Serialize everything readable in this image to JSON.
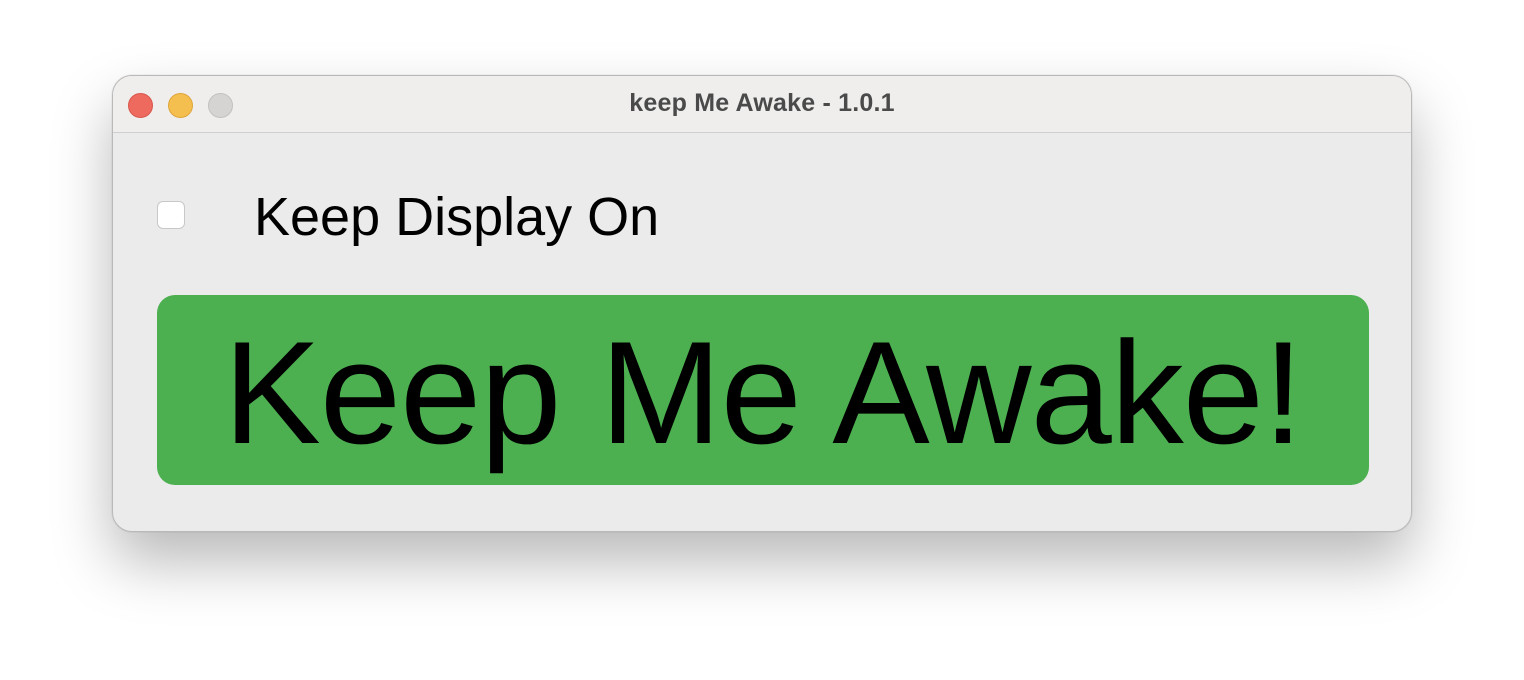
{
  "window": {
    "title": "keep Me Awake - 1.0.1"
  },
  "options": {
    "keep_display_on": {
      "label": "Keep Display On",
      "checked": false
    }
  },
  "main_button": {
    "label": "Keep Me Awake!",
    "color": "#4caf50"
  },
  "colors": {
    "close": "#ee6a5f",
    "minimize": "#f5bf4f",
    "zoom_disabled": "#d5d4d3"
  }
}
